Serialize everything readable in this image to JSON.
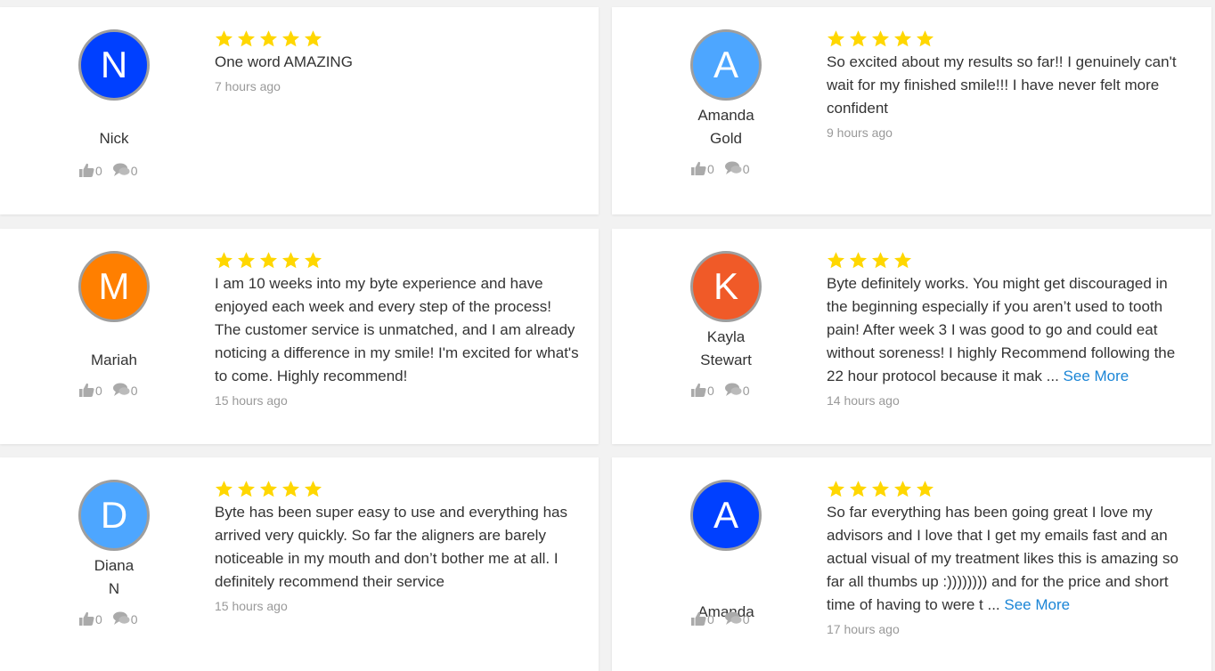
{
  "colors": {
    "star": "#FFD700",
    "link": "#1a85d6",
    "muted": "#999999"
  },
  "reviews": [
    {
      "initial": "N",
      "avatar_color": "#0040ff",
      "name": "Nick",
      "stars": 5,
      "text": "One word AMAZING",
      "see_more": "",
      "time": "7 hours ago",
      "likes": "0",
      "comments": "0"
    },
    {
      "initial": "A",
      "avatar_color": "#4da6ff",
      "name": "Amanda Gold",
      "stars": 5,
      "text": "So excited about my results so far!! I genuinely can't wait for my finished smile!!! I have never felt more confident",
      "see_more": "",
      "time": "9 hours ago",
      "likes": "0",
      "comments": "0"
    },
    {
      "initial": "M",
      "avatar_color": "#ff7f00",
      "name": "Mariah",
      "stars": 5,
      "text": "I am 10 weeks into my byte experience and have enjoyed each week and every step of the process! The customer service is unmatched, and I am already noticing a difference in my smile! I'm excited for what's to come. Highly recommend!",
      "see_more": "",
      "time": "15 hours ago",
      "likes": "0",
      "comments": "0"
    },
    {
      "initial": "K",
      "avatar_color": "#f05a28",
      "name": "Kayla Stewart",
      "stars": 4,
      "text": "Byte definitely works. You might get discouraged in the beginning especially if you aren’t used to tooth pain! After week 3 I was good to go and could eat without soreness! I highly Recommend following the 22 hour protocol because it mak ...",
      "see_more": "See More",
      "time": "14 hours ago",
      "likes": "0",
      "comments": "0"
    },
    {
      "initial": "D",
      "avatar_color": "#4da6ff",
      "name": "Diana N",
      "stars": 5,
      "text": "Byte has been super easy to use and everything has arrived very quickly. So far the aligners are barely noticeable in my mouth and don’t bother me at all. I definitely recommend their service",
      "see_more": "",
      "time": "15 hours ago",
      "likes": "0",
      "comments": "0"
    },
    {
      "initial": "A",
      "avatar_color": "#0040ff",
      "name": "Amanda",
      "stars": 5,
      "text": "So far everything has been going great I love my advisors and I love that I get my emails fast and an actual visual of my treatment likes this is amazing so far all thumbs up :)))))))) and for the price and short time of having to were t ...",
      "see_more": "See More",
      "time": "17 hours ago",
      "likes": "0",
      "comments": "0"
    }
  ]
}
